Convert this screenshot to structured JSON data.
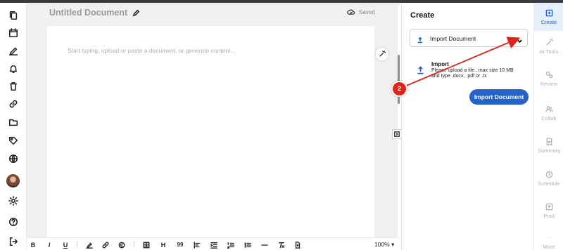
{
  "document": {
    "title": "Untitled Document",
    "save_status": "Saved",
    "placeholder": "Start typing, upload or paste a document, or generate content..."
  },
  "left_sidebar": {
    "icons": [
      "copy-icon",
      "calendar-icon",
      "pen-icon",
      "bell-icon",
      "trash-icon",
      "link-icon",
      "folder-icon",
      "tag-icon",
      "globe-icon",
      "avatar",
      "gear-icon",
      "help-icon",
      "logout-icon"
    ]
  },
  "toolbar": {
    "bold": "B",
    "italic": "I",
    "underline": "U",
    "heading": "H",
    "quote": "99",
    "zoom": "100%"
  },
  "panel": {
    "title": "Create",
    "dropdown_value": "Import Document",
    "import_heading": "Import",
    "import_desc": "Please upload a file , max size 10 MB and type .docx, .pdf or .tx",
    "import_button": "Import Document"
  },
  "right_rail": {
    "items": [
      {
        "label": "Create",
        "icon": "plus-square-icon",
        "active": true
      },
      {
        "label": "AI Tools",
        "icon": "magic-wand-icon",
        "active": false
      },
      {
        "label": "Review",
        "icon": "review-icon",
        "active": false
      },
      {
        "label": "Collab",
        "icon": "users-icon",
        "active": false
      },
      {
        "label": "Summary",
        "icon": "document-icon",
        "active": false
      },
      {
        "label": "Schedule",
        "icon": "clock-icon",
        "active": false
      },
      {
        "label": "Post",
        "icon": "post-icon",
        "active": false
      },
      {
        "label": "More",
        "icon": "more-icon",
        "active": false
      }
    ]
  },
  "annotation": {
    "step_number": "2",
    "color": "#e0241b"
  },
  "colors": {
    "accent": "#2563c9",
    "active_bg": "#e6effc"
  }
}
